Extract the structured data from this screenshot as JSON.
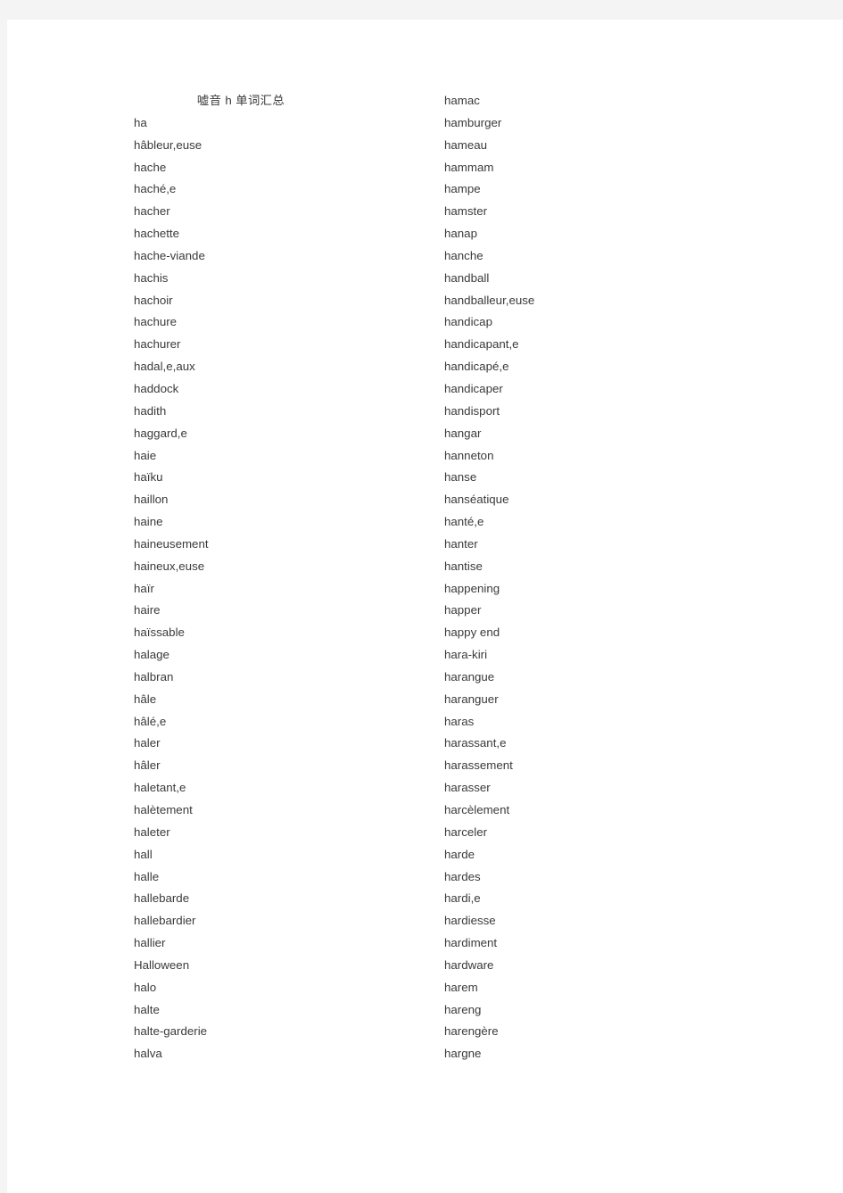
{
  "document": {
    "title": "嘘音 h 单词汇总",
    "background_color": "#f4f4f4",
    "page_color": "#ffffff",
    "text_color": "#3a3a3a"
  },
  "columns": {
    "left": [
      "ha",
      "hâbleur,euse",
      "hache",
      "haché,e",
      "hacher",
      "hachette",
      "hache-viande",
      "hachis",
      "hachoir",
      "hachure",
      "hachurer",
      "hadal,e,aux",
      "haddock",
      "hadith",
      "haggard,e",
      "haie",
      "haïku",
      "haillon",
      "haine",
      "haineusement",
      "haineux,euse",
      "haïr",
      "haire",
      "haïssable",
      "halage",
      "halbran",
      "hâle",
      "hâlé,e",
      "haler",
      "hâler",
      "haletant,e",
      "halètement",
      "haleter",
      "hall",
      "halle",
      "hallebarde",
      "hallebardier",
      "hallier",
      "Halloween",
      "halo",
      "halte",
      "halte-garderie",
      "halva"
    ],
    "right": [
      "hamac",
      "hamburger",
      "hameau",
      "hammam",
      "hampe",
      "hamster",
      "hanap",
      "hanche",
      "handball",
      "handballeur,euse",
      "handicap",
      "handicapant,e",
      "handicapé,e",
      "handicaper",
      "handisport",
      "hangar",
      "hanneton",
      "hanse",
      "hanséatique",
      "hanté,e",
      "hanter",
      "hantise",
      "happening",
      "happer",
      "happy  end",
      "hara-kiri",
      "harangue",
      "haranguer",
      "haras",
      "harassant,e",
      "harassement",
      "harasser",
      "harcèlement",
      "harceler",
      "harde",
      "hardes",
      "hardi,e",
      "hardiesse",
      "hardiment",
      "hardware",
      "harem",
      "hareng",
      "harengère",
      "hargne"
    ]
  }
}
